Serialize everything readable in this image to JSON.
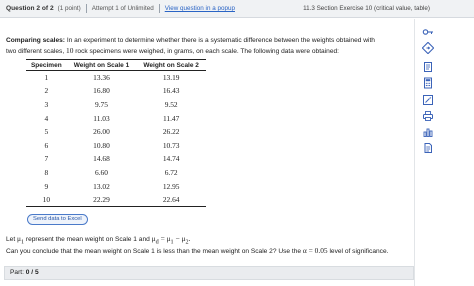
{
  "header": {
    "question_label": "Question 2 of 2",
    "points": "(1 point)",
    "attempt": "Attempt 1 of Unlimited",
    "popup_link": "View question in a popup",
    "section": "11.3 Section Exercise 10 (critical value, table)"
  },
  "problem": {
    "title": "Comparing scales:",
    "line1_a": "In an experiment to determine whether there is a systematic difference between the weights obtained with",
    "line2_a": "two different scales,",
    "line2_n": "10",
    "line2_b": "rock specimens were weighed, in grams, on each scale. The following data were obtained:"
  },
  "table": {
    "headers": [
      "Specimen",
      "Weight on Scale 1",
      "Weight on Scale 2"
    ],
    "rows": [
      [
        "1",
        "13.36",
        "13.19"
      ],
      [
        "2",
        "16.80",
        "16.43"
      ],
      [
        "3",
        "9.75",
        "9.52"
      ],
      [
        "4",
        "11.03",
        "11.47"
      ],
      [
        "5",
        "26.00",
        "26.22"
      ],
      [
        "6",
        "10.80",
        "10.73"
      ],
      [
        "7",
        "14.68",
        "14.74"
      ],
      [
        "8",
        "6.60",
        "6.72"
      ],
      [
        "9",
        "13.02",
        "12.95"
      ],
      [
        "10",
        "22.29",
        "22.64"
      ]
    ]
  },
  "send_button": "Send data to Excel",
  "let": {
    "pre": "Let",
    "mu1": "μ",
    "sub1": "1",
    "mid": "represent the mean weight on Scale 1 and",
    "mud": "μ",
    "subd": "d",
    "eq": "= μ",
    "sub_a": "1",
    "minus": "− μ",
    "sub_b": "2",
    "end": "."
  },
  "question": {
    "text_a": "Can you conclude that the mean weight on Scale 1 is less than the mean weight on Scale 2? Use the",
    "alpha": "α = 0.05",
    "text_b": "level of significance."
  },
  "part": {
    "label": "Part:",
    "value": "0 / 5"
  },
  "sidebar_icons": [
    "key-icon",
    "diamond-arrow-icon",
    "notepad-icon",
    "calculator-icon",
    "wand-icon",
    "printer-icon",
    "bar-chart-icon",
    "document-icon"
  ],
  "colors": {
    "link": "#2a64c5",
    "topbar_bg": "#f0f2f4",
    "part_bg": "#eaecef",
    "icon_blue": "#3b63b8"
  }
}
